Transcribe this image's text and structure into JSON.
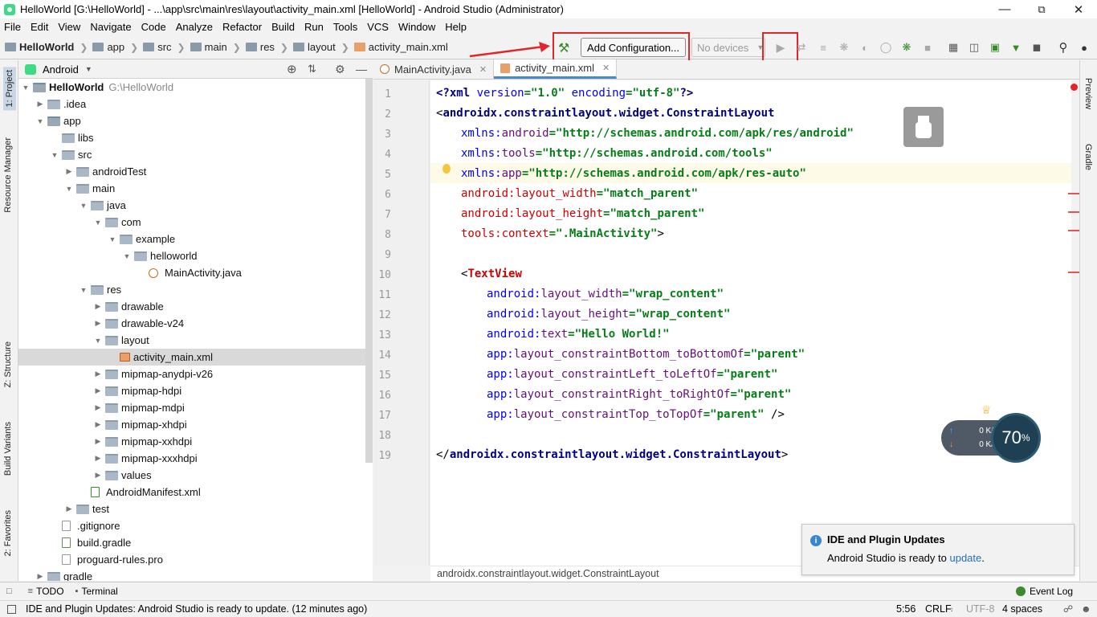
{
  "window": {
    "title": "HelloWorld [G:\\HelloWorld] - ...\\app\\src\\main\\res\\layout\\activity_main.xml [HelloWorld] - Android Studio (Administrator)"
  },
  "menu": [
    "File",
    "Edit",
    "View",
    "Navigate",
    "Code",
    "Analyze",
    "Refactor",
    "Build",
    "Run",
    "Tools",
    "VCS",
    "Window",
    "Help"
  ],
  "breadcrumbs": [
    "HelloWorld",
    "app",
    "src",
    "main",
    "res",
    "layout",
    "activity_main.xml"
  ],
  "toolbar": {
    "add_config_label": "Add Configuration...",
    "device_label": "No devices"
  },
  "left_tabs": [
    "1: Project",
    "Resource Manager",
    "Z: Structure",
    "Build Variants",
    "2: Favorites"
  ],
  "right_tabs": [
    "Preview",
    "Gradle"
  ],
  "project_panel": {
    "view_label": "Android",
    "tree": [
      {
        "label": "HelloWorld",
        "path": "G:\\HelloWorld"
      },
      {
        "label": ".idea"
      },
      {
        "label": "app"
      },
      {
        "label": "libs"
      },
      {
        "label": "src"
      },
      {
        "label": "androidTest"
      },
      {
        "label": "main"
      },
      {
        "label": "java"
      },
      {
        "label": "com"
      },
      {
        "label": "example"
      },
      {
        "label": "helloworld"
      },
      {
        "label": "MainActivity.java"
      },
      {
        "label": "res"
      },
      {
        "label": "drawable"
      },
      {
        "label": "drawable-v24"
      },
      {
        "label": "layout"
      },
      {
        "label": "activity_main.xml"
      },
      {
        "label": "mipmap-anydpi-v26"
      },
      {
        "label": "mipmap-hdpi"
      },
      {
        "label": "mipmap-mdpi"
      },
      {
        "label": "mipmap-xhdpi"
      },
      {
        "label": "mipmap-xxhdpi"
      },
      {
        "label": "mipmap-xxxhdpi"
      },
      {
        "label": "values"
      },
      {
        "label": "AndroidManifest.xml"
      },
      {
        "label": "test"
      },
      {
        "label": ".gitignore"
      },
      {
        "label": "build.gradle"
      },
      {
        "label": "proguard-rules.pro"
      },
      {
        "label": "gradle"
      }
    ]
  },
  "editor_tabs": [
    "MainActivity.java",
    "activity_main.xml"
  ],
  "line_numbers": [
    "1",
    "2",
    "3",
    "4",
    "5",
    "6",
    "7",
    "8",
    "9",
    "10",
    "11",
    "12",
    "13",
    "14",
    "15",
    "16",
    "17",
    "18",
    "19"
  ],
  "code": {
    "l1a": "<?",
    "l1b": "xml ",
    "l1c": "version",
    "l1d": "=\"1.0\" ",
    "l1e": "encoding",
    "l1f": "=\"utf-8\"",
    "l1g": "?>",
    "l2a": "<",
    "l2b": "androidx.constraintlayout.widget.ConstraintLayout",
    "l3a": "xmlns:",
    "l3b": "android",
    "l3c": "=\"http://schemas.android.com/apk/res/android\"",
    "l4a": "xmlns:",
    "l4b": "tools",
    "l4c": "=\"http://schemas.android.com/tools\"",
    "l5a": "xmlns:",
    "l5b": "app",
    "l5c": "=\"http://schemas.android.com/apk/res-auto\"",
    "l6a": "android:",
    "l6b": "layout_width",
    "l6c": "=\"match_parent\"",
    "l7a": "android:",
    "l7b": "layout_height",
    "l7c": "=\"match_parent\"",
    "l8a": "tools:",
    "l8b": "context",
    "l8c": "=\".MainActivity\"",
    "l8d": ">",
    "l10a": "<",
    "l10b": "TextView",
    "l11a": "android:",
    "l11b": "layout_width",
    "l11c": "=\"wrap_content\"",
    "l12a": "android:",
    "l12b": "layout_height",
    "l12c": "=\"wrap_content\"",
    "l13a": "android:",
    "l13b": "text",
    "l13c": "=\"Hello World!\"",
    "l14a": "app:",
    "l14b": "layout_constraintBottom_toBottomOf",
    "l14c": "=\"parent\"",
    "l15a": "app:",
    "l15b": "layout_constraintLeft_toLeftOf",
    "l15c": "=\"parent\"",
    "l16a": "app:",
    "l16b": "layout_constraintRight_toRightOf",
    "l16c": "=\"parent\"",
    "l17a": "app:",
    "l17b": "layout_constraintTop_toTopOf",
    "l17c": "=\"parent\"",
    "l17d": " />",
    "l19a": "</",
    "l19b": "androidx.constraintlayout.widget.ConstraintLayout",
    "l19c": ">"
  },
  "editor_breadcrumb": "androidx.constraintlayout.widget.ConstraintLayout",
  "notification": {
    "title": "IDE and Plugin Updates",
    "body": "Android Studio is ready to ",
    "link": "update",
    "tail": "."
  },
  "net_widget": {
    "up": "0 K/s",
    "down": "0 K/s",
    "percent": "70",
    "unit": "%"
  },
  "bottom_tools": {
    "todo": "TODO",
    "terminal": "Terminal",
    "event_log": "Event Log"
  },
  "status": {
    "message": "IDE and Plugin Updates: Android Studio is ready to update. (12 minutes ago)",
    "position": "5:56",
    "line_sep": "CRLF",
    "encoding": "UTF-8",
    "indent": "4 spaces"
  },
  "colors": {
    "accent": "#4a88c7",
    "highlight_red": "#e0262a",
    "tag": "#000080",
    "value": "#067d17"
  }
}
